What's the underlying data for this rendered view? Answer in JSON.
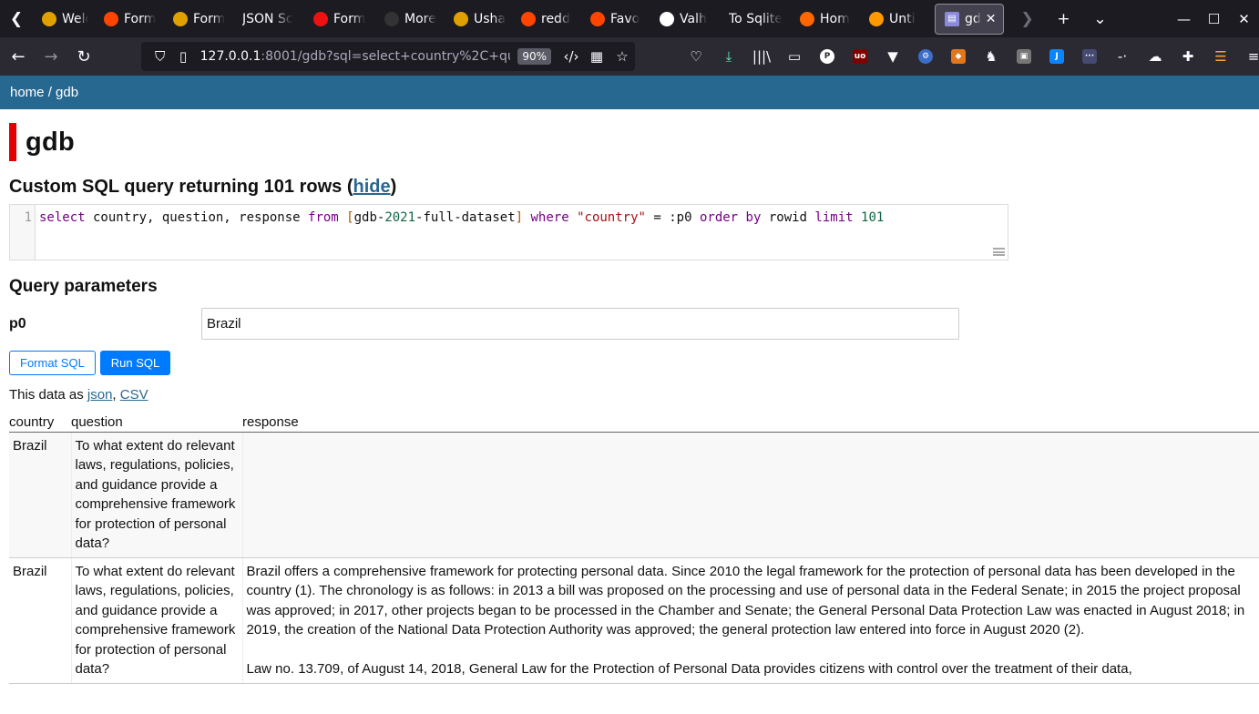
{
  "browser": {
    "tabs": [
      {
        "title": "Welc",
        "favicon": "bee-icon",
        "color": "#e0a100"
      },
      {
        "title": "Form",
        "favicon": "reddit-icon",
        "color": "#ff4500"
      },
      {
        "title": "Form",
        "favicon": "terminal-icon",
        "color": "#e0a100"
      },
      {
        "title": "JSON Sc",
        "favicon": "none",
        "color": "#1c1b22"
      },
      {
        "title": "Form",
        "favicon": "feather-icon",
        "color": "#e11"
      },
      {
        "title": "More",
        "favicon": "square-icon",
        "color": "#333"
      },
      {
        "title": "Usha",
        "favicon": "bee-icon",
        "color": "#e0a100"
      },
      {
        "title": "redd",
        "favicon": "reddit-icon",
        "color": "#ff4500"
      },
      {
        "title": "Favo",
        "favicon": "reddit-icon",
        "color": "#ff4500"
      },
      {
        "title": "Valh",
        "favicon": "wikipedia-icon",
        "color": "#fff"
      },
      {
        "title": "To Sqlite",
        "favicon": "none",
        "color": "#1c1b22"
      },
      {
        "title": "Hom",
        "favicon": "ring-icon",
        "color": "#f60"
      },
      {
        "title": "Unti",
        "favicon": "hourglass-icon",
        "color": "#f90"
      }
    ],
    "active_tab": {
      "title": "gd",
      "close": "✕"
    },
    "url_host": "127.0.0.1",
    "url_rest": ":8001/gdb?sql=select+country%2C+que",
    "zoom": "90%"
  },
  "page": {
    "breadcrumb_home": "home",
    "breadcrumb_sep": " / ",
    "breadcrumb_db": "gdb",
    "title": "gdb",
    "query_heading": "Custom SQL query returning 101 rows (",
    "hide_link": "hide",
    "query_heading_end": ")",
    "line_number": "1",
    "params_heading": "Query parameters",
    "param_name": "p0",
    "param_value": "Brazil",
    "format_button": "Format SQL",
    "run_button": "Run SQL",
    "export_prefix": "This data as ",
    "export_json": "json",
    "export_sep": ", ",
    "export_csv": "CSV"
  },
  "sql_tokens": [
    {
      "t": "select",
      "c": "kw"
    },
    {
      "t": " country, question, response ",
      "c": ""
    },
    {
      "t": "from",
      "c": "kw"
    },
    {
      "t": " ",
      "c": ""
    },
    {
      "t": "[",
      "c": "br"
    },
    {
      "t": "gdb-",
      "c": ""
    },
    {
      "t": "2021",
      "c": "num"
    },
    {
      "t": "-full-dataset",
      "c": ""
    },
    {
      "t": "]",
      "c": "br"
    },
    {
      "t": " ",
      "c": ""
    },
    {
      "t": "where",
      "c": "kw"
    },
    {
      "t": " ",
      "c": ""
    },
    {
      "t": "\"country\"",
      "c": "str"
    },
    {
      "t": " = :p0 ",
      "c": ""
    },
    {
      "t": "order by",
      "c": "kw"
    },
    {
      "t": " rowid ",
      "c": ""
    },
    {
      "t": "limit",
      "c": "kw"
    },
    {
      "t": " ",
      "c": ""
    },
    {
      "t": "101",
      "c": "num"
    }
  ],
  "table": {
    "columns": [
      "country",
      "question",
      "response"
    ],
    "rows": [
      {
        "country": "Brazil",
        "question": "To what extent do relevant laws, regulations, policies, and guidance provide a comprehensive framework for protection of personal data?",
        "response": []
      },
      {
        "country": "Brazil",
        "question": "To what extent do relevant laws, regulations, policies, and guidance provide a comprehensive framework for protection of personal data?",
        "response": [
          "Brazil offers a comprehensive framework for protecting personal data. Since 2010 the legal framework for the protection of personal data has been developed in the country (1). The chronology is as follows: in 2013 a bill was proposed on the processing and use of personal data in the Federal Senate; in 2015 the project proposal was approved; in 2017, other projects began to be processed in the Chamber and Senate; the General Personal Data Protection Law was enacted in August 2018; in 2019, the creation of the National Data Protection Authority was approved; the general protection law entered into force in August 2020 (2).",
          "Law no. 13.709, of August 14, 2018, General Law for the Protection of Personal Data provides citizens with control over the treatment of their data,"
        ]
      }
    ]
  }
}
